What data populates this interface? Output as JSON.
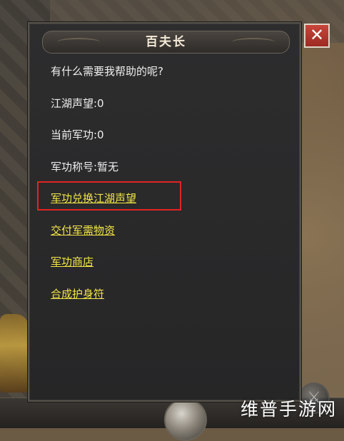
{
  "dialog": {
    "title": "百夫长",
    "prompt": "有什么需要我帮助的呢?",
    "reputation": "江湖声望:0",
    "merit": "当前军功:0",
    "merit_title": "军功称号:暂无",
    "options": [
      "军功兑换江湖声望",
      "交付军需物资",
      "军功商店",
      "合成护身符"
    ],
    "close_label": "✕"
  },
  "watermark": "维普手游网",
  "colors": {
    "option_text": "#f2e545",
    "highlight_box": "#e02424",
    "close_button": "#c9453a"
  }
}
